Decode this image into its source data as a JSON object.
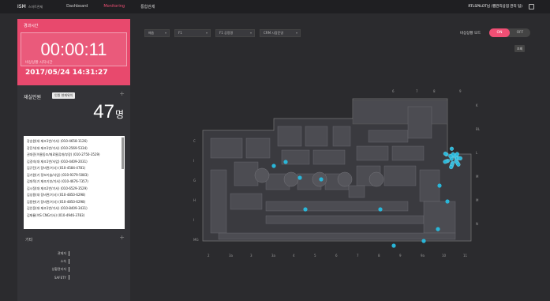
{
  "topbar": {
    "logo": "ISM",
    "logo_sub": "스마트관제",
    "nav": [
      "Dashboard",
      "Monitoring",
      "통합관제"
    ],
    "active_nav": "Monitoring",
    "user": "RTLSPILOT님 (웹관리상점 관리 팀)"
  },
  "timer": {
    "label": "경과시간",
    "value": "00:00:11",
    "start_label": "비상상황 시작시간",
    "start_time": "2017/05/24 14:31:27"
  },
  "occupants": {
    "title": "재실인원",
    "button": "인원 현재위치",
    "count": "47",
    "unit": "명",
    "list": [
      "강승원(대 재조1반/기사) (010-4658-1126)",
      "강진석(대 재조1반/기사) (010-2569-5334)",
      "권대준(이물동조/재료물류개/부장) (010-2750-3529)",
      "김경숙(대 재조1반/사업) (010-4409-2031)",
      "김규진(기 장비관/기사) (010-4584-4781)",
      "김기원(기 정보기술/사업) (010-9379-5083)",
      "김대욱(기 재조기부/기사) (010-4676-7357)",
      "김시정(대 재조2반/기사) (010-6529-3529)",
      "김성용(대 장비관/기사) (010-4850-6298)",
      "김용현(기 장비관/기사) (010-4850-6298)",
      "김인웅(대 재조1반/기사) (010-8409-3431)",
      "김재룡(이S CNG기사) (010-4946-3783)"
    ]
  },
  "groups": {
    "label": "기타",
    "rows": [
      "관제자",
      "소속",
      "상황관리자",
      "SAFETY"
    ]
  },
  "filters": {
    "items": [
      "배송",
      "F1",
      "F1 공정명",
      "CRM 시장운영"
    ]
  },
  "mode": {
    "label": "비상상황 모드",
    "on": "ON",
    "off": "OFF",
    "button": "조회"
  },
  "map": {
    "top_labels": [
      "6",
      "7",
      "8",
      "9"
    ],
    "bottom_labels": [
      "2",
      "3a",
      "3",
      "3a",
      "4",
      "5",
      "6",
      "7",
      "8",
      "9",
      "9a",
      "10",
      "11"
    ],
    "left_labels": [
      "C",
      "I",
      "G",
      "H",
      "I",
      "MG"
    ],
    "right_labels": [
      "K",
      "BL",
      "L",
      "M",
      "M",
      "N"
    ],
    "accent_color": "#29b6d8"
  }
}
